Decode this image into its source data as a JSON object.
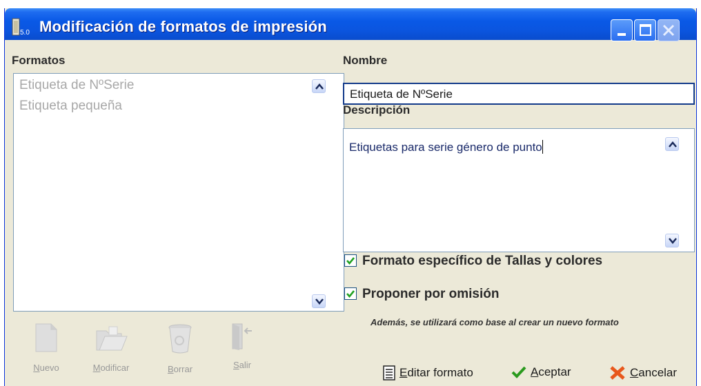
{
  "window": {
    "title": "Modificación de formatos de impresión",
    "app_icon": "app-version-icon",
    "app_icon_text": "5.0"
  },
  "formatos": {
    "label": "Formatos",
    "items": [
      "Etiqueta de NºSerie",
      "Etiqueta pequeña"
    ]
  },
  "nombre": {
    "label": "Nombre",
    "value": "Etiqueta de NºSerie"
  },
  "descripcion": {
    "label": "Descripción",
    "value": "Etiquetas para serie género de punto"
  },
  "options": {
    "tallas_label": "Formato específico de Tallas y colores",
    "tallas_checked": true,
    "omision_label": "Proponer por omisión",
    "omision_checked": true,
    "note": "Además, se utilizará como base al crear un nuevo formato"
  },
  "toolbar": {
    "nuevo_u": "N",
    "nuevo_rest": "uevo",
    "modificar_u": "M",
    "modificar_rest": "odificar",
    "borrar_u": "B",
    "borrar_rest": "orrar",
    "salir_u": "S",
    "salir_rest": "alir"
  },
  "actions": {
    "editar_u": "E",
    "editar_rest": "ditar formato",
    "aceptar_u": "A",
    "aceptar_rest": "ceptar",
    "cancelar_u": "C",
    "cancelar_rest": "ancelar"
  },
  "colors": {
    "titlebar": "#0a59e6",
    "dialog_bg": "#ece9d8",
    "accept_green": "#2a9a1e",
    "cancel_orange": "#e8581c"
  }
}
